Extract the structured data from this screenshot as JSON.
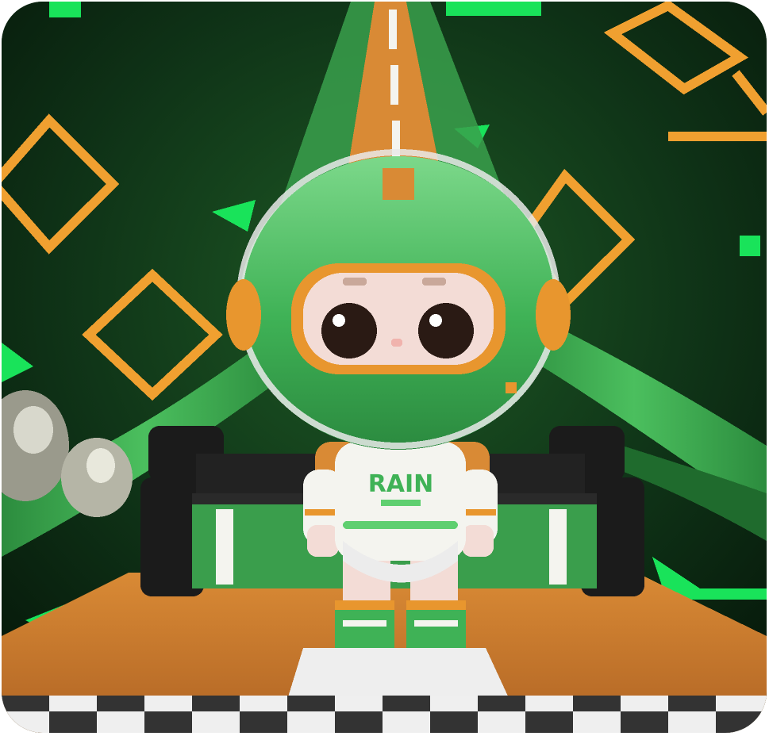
{
  "image": {
    "description_tags": [
      "cartoon-racer-figure",
      "green-helmet",
      "go-kart",
      "checkered-finish-line",
      "neon-background"
    ],
    "colors": {
      "background_dark": "#0b2a12",
      "background_mid": "#123d1a",
      "neon_green": "#19e35a",
      "neon_orange": "#f0a030",
      "helmet_green": "#3fb256",
      "helmet_light": "#6fd07f",
      "visor_orange": "#e8962e",
      "face": "#f3dcd6",
      "eyes": "#2a1a14",
      "suit_white": "#f4f4ef",
      "kart_black": "#1b1b1b",
      "kart_green": "#3a9e4c",
      "floor_orange": "#c8782e",
      "checker_dark": "#333333",
      "checker_light": "#efefef"
    },
    "suit_text": "RAIN"
  }
}
